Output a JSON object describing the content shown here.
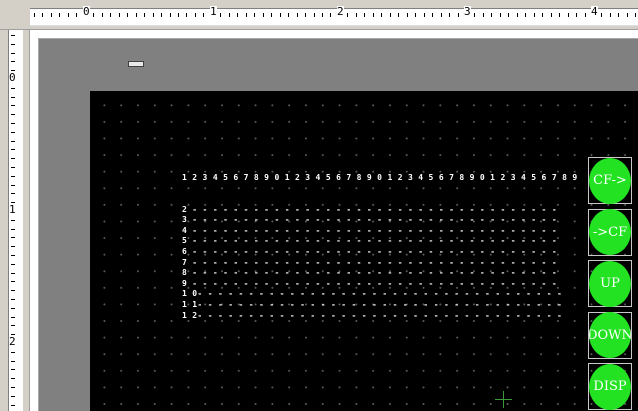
{
  "ruler": {
    "horizontal_labels": [
      "0",
      "1",
      "2",
      "3",
      "4"
    ],
    "vertical_labels": [
      "0",
      "1",
      "2"
    ]
  },
  "grid": {
    "header": "1 2 3 4 5 6 7 8 9 0 1 2 3 4 5 6 7 8 9 0 1 2 3 4 5 6 7 8 9 0 1 2 3 4 5 6 7 8 9",
    "row_numbers": [
      "2",
      "3",
      "4",
      "5",
      "6",
      "7",
      "8",
      "9",
      "1 0",
      "1 1",
      "1 2"
    ]
  },
  "buttons": [
    {
      "label": "CF->",
      "color": "#22e222"
    },
    {
      "label": "->CF",
      "color": "#22e222"
    },
    {
      "label": "UP",
      "color": "#22e222"
    },
    {
      "label": "DOWN",
      "color": "#22e222"
    },
    {
      "label": "DISP",
      "color": "#22e222"
    }
  ],
  "colors": {
    "screen_background": "#000000",
    "frame": "#808080",
    "button_fill": "#22e222"
  }
}
